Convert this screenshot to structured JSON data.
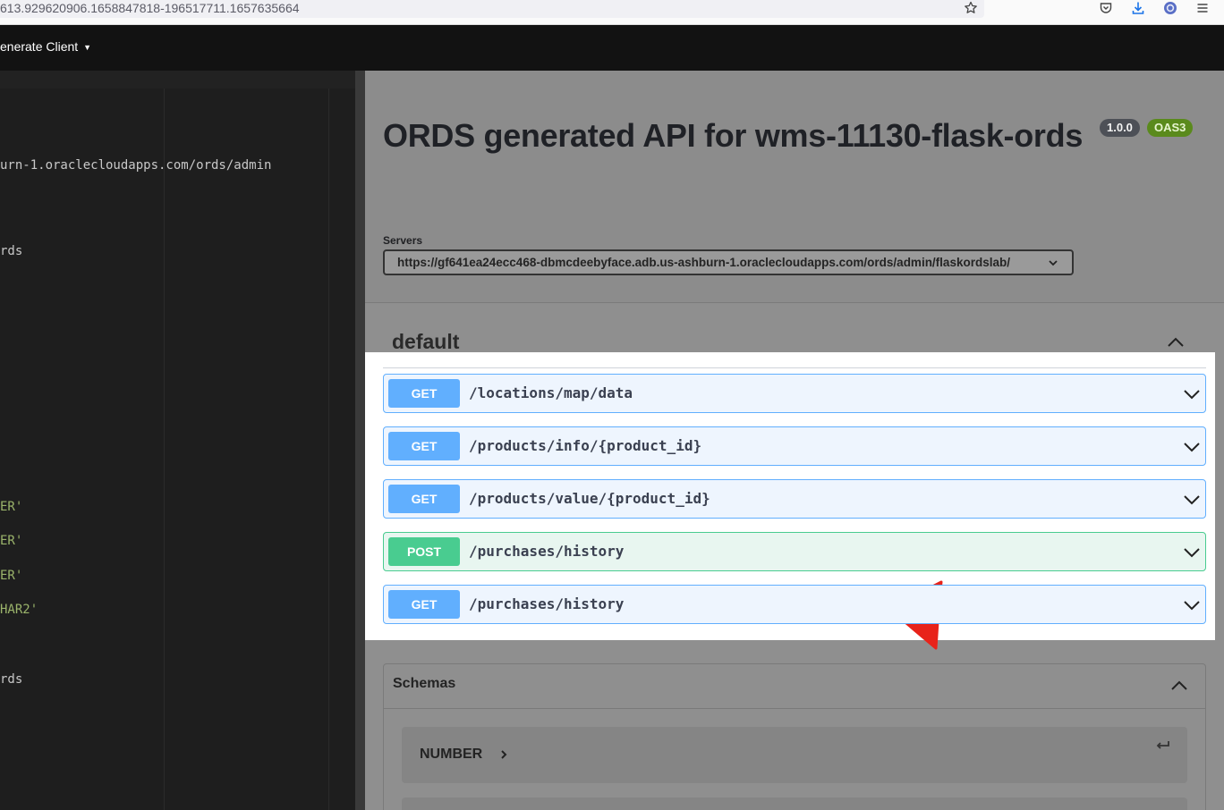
{
  "browser": {
    "url_text": "613.929620906.1658847818-196517711.1657635664",
    "icons": [
      "star-icon",
      "pocket-icon",
      "download-icon",
      "account-icon",
      "menu-icon"
    ]
  },
  "editor": {
    "generate_client_label": "enerate Client",
    "code_lines": [
      {
        "text": "urn-1.oraclecloudapps.com/ords/admin",
        "kind": "plain"
      },
      {
        "text": "rds",
        "kind": "plain"
      },
      {
        "text": "ER'",
        "kind": "string"
      },
      {
        "text": "ER'",
        "kind": "string"
      },
      {
        "text": "ER'",
        "kind": "string"
      },
      {
        "text": "HAR2'",
        "kind": "string"
      },
      {
        "text": "rds",
        "kind": "plain"
      }
    ]
  },
  "swagger": {
    "title": "ORDS generated API for wms-11130-flask-ords",
    "version_badge": "1.0.0",
    "oas_badge": "OAS3",
    "servers_label": "Servers",
    "server_url": "https://gf641ea24ecc468-dbmcdeebyface.adb.us-ashburn-1.oraclecloudapps.com/ords/admin/flaskordslab/",
    "default_section": "default",
    "operations": [
      {
        "method": "GET",
        "path": "/locations/map/data"
      },
      {
        "method": "GET",
        "path": "/products/info/{product_id}"
      },
      {
        "method": "GET",
        "path": "/products/value/{product_id}"
      },
      {
        "method": "POST",
        "path": "/purchases/history"
      },
      {
        "method": "GET",
        "path": "/purchases/history"
      }
    ],
    "schemas_title": "Schemas",
    "schemas": [
      "NUMBER"
    ]
  },
  "colors": {
    "get": "#61affe",
    "post": "#49cc90",
    "annotation_arrow": "#e8231a"
  }
}
